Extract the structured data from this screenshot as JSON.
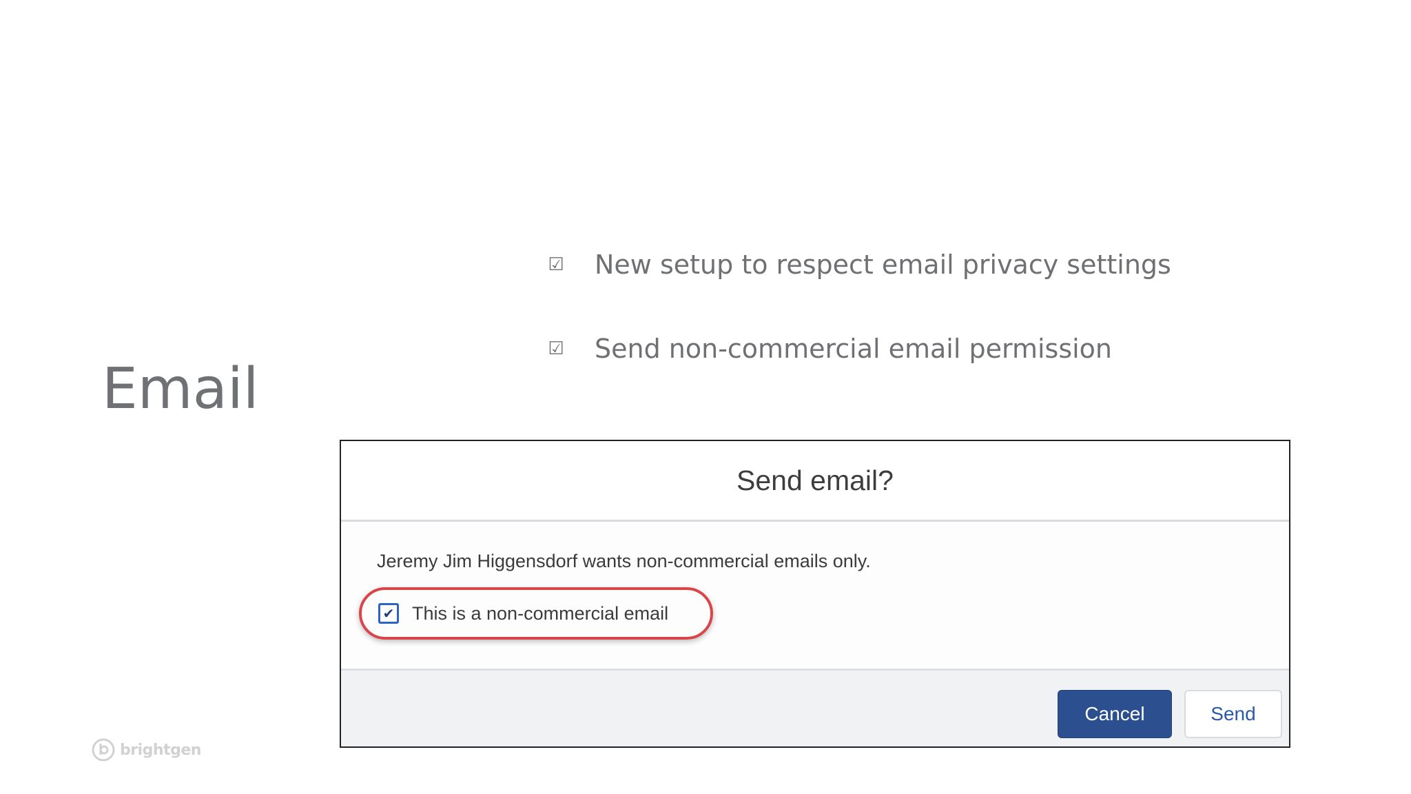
{
  "slide": {
    "title": "Email"
  },
  "bullets": [
    {
      "icon": "checkbox-icon",
      "glyph": "☑",
      "text": "New setup to respect email privacy settings"
    },
    {
      "icon": "checkbox-icon",
      "glyph": "☑",
      "text": "Send non-commercial email permission"
    }
  ],
  "modal": {
    "title": "Send email?",
    "message": "Jeremy Jim Higgensdorf wants non-commercial emails only.",
    "checkbox": {
      "label": "This is a non-commercial email",
      "checked": true,
      "mark": "✔"
    },
    "buttons": {
      "cancel_label": "Cancel",
      "send_label": "Send"
    }
  },
  "logo": {
    "text": "brightgen"
  },
  "colors": {
    "title_gray": "#707175",
    "highlight_red": "#d9464a",
    "primary_blue": "#2b4f8f",
    "checkbox_blue": "#2c62c9"
  }
}
